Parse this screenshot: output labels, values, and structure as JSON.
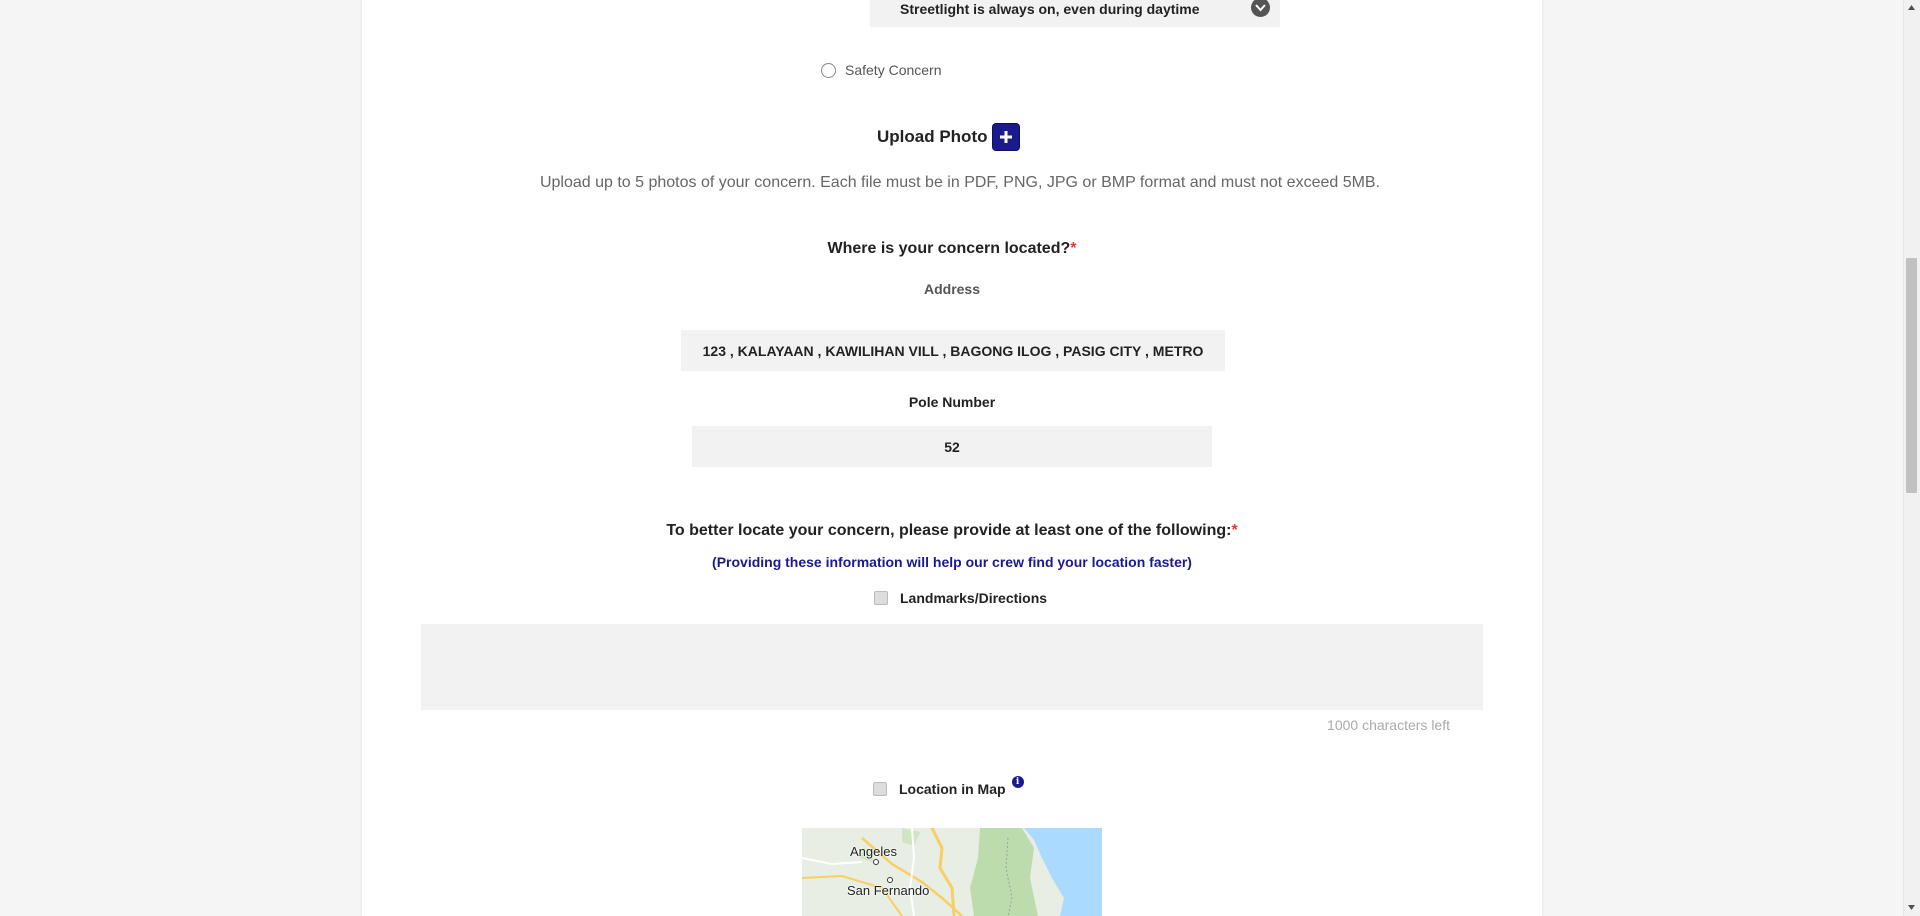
{
  "dropdown": {
    "selected": "Streetlight is always on, even during daytime",
    "icon": "chevron-down-icon"
  },
  "concern_type": {
    "safety_label": "Safety Concern"
  },
  "upload": {
    "title": "Upload Photo",
    "button_icon": "plus-icon",
    "description": "Upload up to 5 photos of your concern. Each file must be in PDF, PNG, JPG or BMP format and must not exceed 5MB."
  },
  "location": {
    "title": "Where is your concern located?",
    "required_mark": "*",
    "address_label": "Address",
    "address_value": "123 , KALAYAAN , KAWILIHAN VILL , BAGONG ILOG , PASIG CITY , METRO",
    "pole_label": "Pole Number",
    "pole_value": "52"
  },
  "locate": {
    "title": "To better locate your concern, please provide at least one of the following:",
    "required_mark": "*",
    "hint": "(Providing these information will help our crew find your location faster)",
    "landmarks_label": "Landmarks/Directions",
    "landmarks_value": "",
    "char_count": "1000 characters left",
    "map_label": "Location in Map",
    "info_icon": "info-icon"
  },
  "map": {
    "places": [
      "Angeles",
      "San Fernando"
    ],
    "colors": {
      "land": "#e8eee4",
      "water": "#aadaff",
      "forest": "#bcdcae",
      "roads": "#f6cf65"
    }
  },
  "colors": {
    "accent": "#1a1a8c",
    "required": "#e53935",
    "field_bg": "#f2f2f2"
  }
}
